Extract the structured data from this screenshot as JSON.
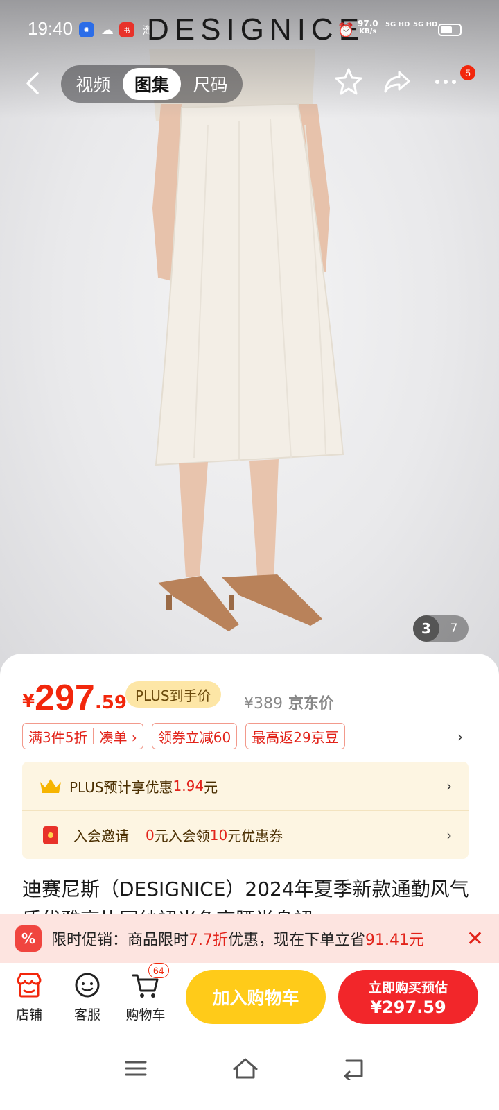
{
  "status_bar": {
    "time": "19:40",
    "app_icons": [
      "baidu-icon",
      "chat-icon",
      "xiaohongshu-icon",
      "taobao-icon"
    ],
    "taobao": "淘",
    "brand_watermark": "DESIGNICE",
    "net_speed": "97.0",
    "net_unit": "KB/s",
    "sim1": "5G HD",
    "sim2": "5G HD"
  },
  "nav": {
    "tabs": [
      {
        "label": "视频"
      },
      {
        "label": "图集"
      },
      {
        "label": "尺码"
      }
    ],
    "active_tab": 1,
    "message_badge": "5"
  },
  "gallery": {
    "current": "3",
    "total": "7"
  },
  "price": {
    "currency": "¥",
    "integer": "297",
    "decimal": ".59",
    "plus_tag": "PLUS到手价",
    "original": "¥389",
    "original_label": "京东价"
  },
  "promotions": {
    "chip1_main": "满3件5折",
    "chip1_link": "凑单 ›",
    "chip2": "领券立减60",
    "chip3": "最高返29京豆",
    "more": "›"
  },
  "plus_card": {
    "row1_prefix": "PLUS预计享优惠",
    "row1_value": "1.94",
    "row1_suffix": "元",
    "row2_label": "入会邀请",
    "row2_v1": "0",
    "row2_t1": "元入会领",
    "row2_v2": "10",
    "row2_t2": "元优惠券",
    "chevron": "›"
  },
  "product": {
    "title": "迪赛尼斯（DESIGNICE）2024年夏季新款通勤风气质优雅亮片网纱裙米色高腰半身裙"
  },
  "promo_banner": {
    "icon_text": "%",
    "label": "限时促销：商品限时",
    "discount": "7.7折",
    "mid": "优惠，现在下单立省",
    "save": "91.41元",
    "close": "✕"
  },
  "actions": {
    "store": "店铺",
    "service": "客服",
    "cart": "购物车",
    "cart_count": "64",
    "add_to_cart": "加入购物车",
    "buy_now_label": "立即购买预估",
    "buy_now_price": "¥297.59"
  },
  "colors": {
    "accent_red": "#f2270c",
    "cart_yellow": "#ffcb19",
    "plus_gold": "#fde6a6"
  }
}
